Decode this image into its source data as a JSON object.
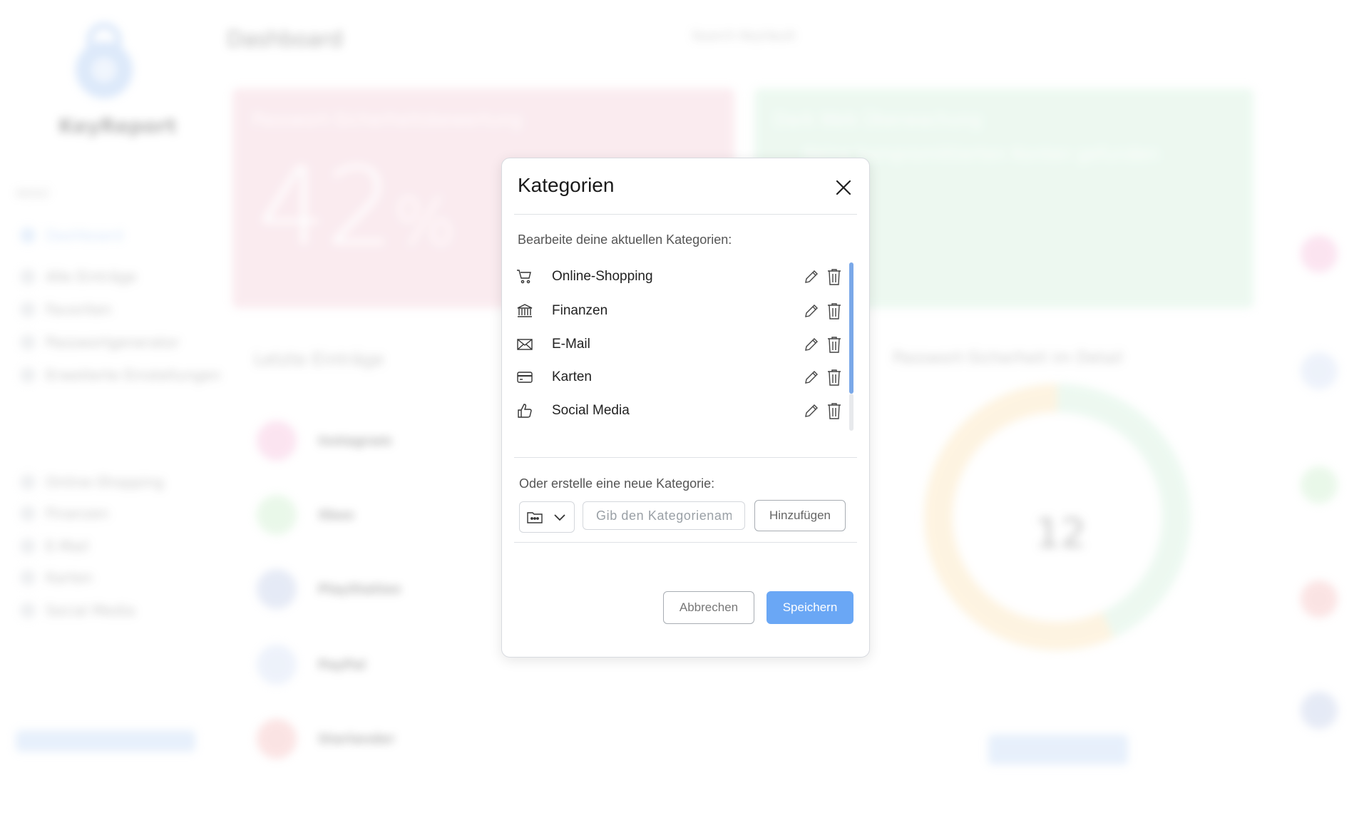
{
  "background": {
    "app_name": "KeyReport",
    "page_title": "Dashboard",
    "search_placeholder": "Search KeyVault",
    "menu_heading": "MENÜ",
    "sidebar_items": [
      "Dashboard",
      "Alle Einträge",
      "Favoriten",
      "Passwortgenerator",
      "Erweiterte Einstellungen"
    ],
    "category_items": [
      "Online-Shopping",
      "Finanzen",
      "E-Mail",
      "Karten",
      "Social Media"
    ],
    "card_red_title": "Passwort-Sicherheitsbewertung",
    "card_red_value": "42",
    "card_red_unit": "%",
    "card_green_title": "Dark Web Überwachung",
    "card_green_status": "Keine kompromittierten Konten gefunden",
    "entries_title": "Letzte Einträge",
    "entries": [
      "Instagram",
      "Xbox",
      "PlayStation",
      "PayPal",
      "Starlander"
    ],
    "donut_title": "Passwort-Sicherheit im Detail",
    "donut_value": "12"
  },
  "modal": {
    "title": "Kategorien",
    "edit_subtitle": "Bearbeite deine aktuellen Kategorien:",
    "categories": [
      {
        "label": "Online-Shopping",
        "icon": "cart-icon"
      },
      {
        "label": "Finanzen",
        "icon": "bank-icon"
      },
      {
        "label": "E-Mail",
        "icon": "envelope-icon"
      },
      {
        "label": "Karten",
        "icon": "credit-card-icon"
      },
      {
        "label": "Social Media",
        "icon": "thumbs-up-icon"
      }
    ],
    "new_label": "Oder erstelle eine neue Kategorie:",
    "name_placeholder": "Gib den Kategorienam",
    "add_label": "Hinzufügen",
    "cancel_label": "Abbrechen",
    "save_label": "Speichern",
    "accent_color": "#6aa7f5"
  }
}
